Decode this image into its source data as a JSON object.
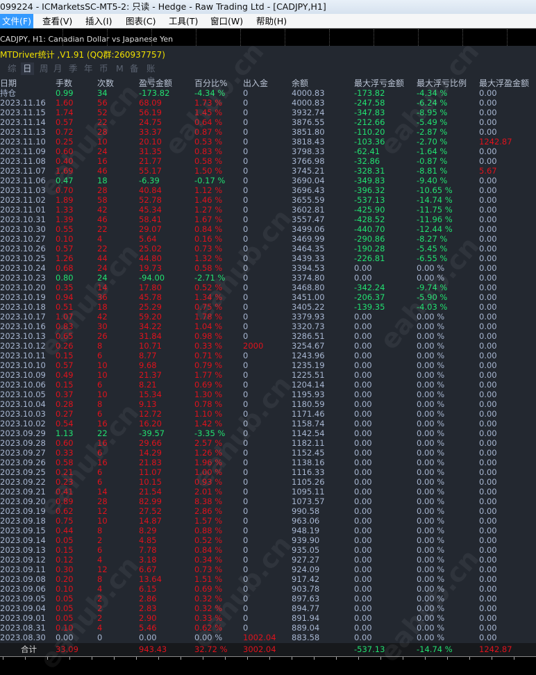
{
  "window": {
    "title": "099224 - ICMarketsSC-MT5-2: 只读 - Hedge - Raw Trading Ltd - [CADJPY,H1]"
  },
  "menu": [
    "文件(F)",
    "查看(V)",
    "插入(I)",
    "图表(C)",
    "工具(T)",
    "窗口(W)",
    "帮助(H)"
  ],
  "chart": {
    "symbol": "CADJPY, H1:  Canadian Dollar vs Japanese Yen"
  },
  "indicator": {
    "title": "MTDriver统计 ,V1.91 (QQ群:260937757)"
  },
  "tabs": [
    "综",
    "日",
    "周",
    "月",
    "季",
    "年",
    "币",
    "M",
    "备",
    "账户"
  ],
  "selected_tab": "日",
  "columns": [
    "日期",
    "手数",
    "次数",
    "盈亏金额",
    "百分比%",
    "出入金",
    "余额",
    "最大浮亏金额",
    "最大浮亏比例",
    "最大浮盈金额"
  ],
  "rows": [
    [
      "持仓",
      "0.99",
      "34",
      "-173.82",
      "-4.34 %",
      "0",
      "4000.83",
      "-173.82",
      "-4.34 %",
      "0.00"
    ],
    [
      "2023.11.16",
      "1.60",
      "56",
      "68.09",
      "1.73 %",
      "0",
      "4000.83",
      "-247.58",
      "-6.24 %",
      "0.00"
    ],
    [
      "2023.11.15",
      "1.74",
      "52",
      "56.19",
      "1.45 %",
      "0",
      "3932.74",
      "-347.83",
      "-8.95 %",
      "0.00"
    ],
    [
      "2023.11.14",
      "0.57",
      "22",
      "24.75",
      "0.64 %",
      "0",
      "3876.55",
      "-212.66",
      "-5.49 %",
      "0.00"
    ],
    [
      "2023.11.13",
      "0.72",
      "28",
      "33.37",
      "0.87 %",
      "0",
      "3851.80",
      "-110.20",
      "-2.87 %",
      "0.00"
    ],
    [
      "2023.11.10",
      "0.25",
      "10",
      "20.10",
      "0.53 %",
      "0",
      "3818.43",
      "-103.36",
      "-2.70 %",
      "1242.87"
    ],
    [
      "2023.11.09",
      "0.60",
      "24",
      "31.35",
      "0.83 %",
      "0",
      "3798.33",
      "-62.41",
      "-1.64 %",
      "0.00"
    ],
    [
      "2023.11.08",
      "0.40",
      "16",
      "21.77",
      "0.58 %",
      "0",
      "3766.98",
      "-32.86",
      "-0.87 %",
      "0.00"
    ],
    [
      "2023.11.07",
      "1.69",
      "46",
      "55.17",
      "1.50 %",
      "0",
      "3745.21",
      "-328.31",
      "-8.81 %",
      "5.67"
    ],
    [
      "2023.11.06",
      "0.47",
      "18",
      "-6.39",
      "-0.17 %",
      "0",
      "3690.04",
      "-349.83",
      "-9.40 %",
      "0.00"
    ],
    [
      "2023.11.03",
      "0.70",
      "28",
      "40.84",
      "1.12 %",
      "0",
      "3696.43",
      "-396.32",
      "-10.65 %",
      "0.00"
    ],
    [
      "2023.11.02",
      "1.89",
      "58",
      "52.78",
      "1.46 %",
      "0",
      "3655.59",
      "-537.13",
      "-14.74 %",
      "0.00"
    ],
    [
      "2023.11.01",
      "1.33",
      "42",
      "45.34",
      "1.27 %",
      "0",
      "3602.81",
      "-425.90",
      "-11.75 %",
      "0.00"
    ],
    [
      "2023.10.31",
      "1.39",
      "46",
      "58.41",
      "1.67 %",
      "0",
      "3557.47",
      "-428.52",
      "-11.96 %",
      "0.00"
    ],
    [
      "2023.10.30",
      "0.55",
      "22",
      "29.07",
      "0.84 %",
      "0",
      "3499.06",
      "-440.70",
      "-12.44 %",
      "0.00"
    ],
    [
      "2023.10.27",
      "0.10",
      "4",
      "5.64",
      "0.16 %",
      "0",
      "3469.99",
      "-290.86",
      "-8.27 %",
      "0.00"
    ],
    [
      "2023.10.26",
      "0.57",
      "22",
      "25.02",
      "0.73 %",
      "0",
      "3464.35",
      "-190.28",
      "-5.45 %",
      "0.00"
    ],
    [
      "2023.10.25",
      "1.26",
      "44",
      "44.80",
      "1.32 %",
      "0",
      "3439.33",
      "-226.81",
      "-6.55 %",
      "0.00"
    ],
    [
      "2023.10.24",
      "0.68",
      "24",
      "19.73",
      "0.58 %",
      "0",
      "3394.53",
      "0.00",
      "0.00 %",
      "0.00"
    ],
    [
      "2023.10.23",
      "0.80",
      "24",
      "-94.00",
      "-2.71 %",
      "0",
      "3374.80",
      "0.00",
      "0.00 %",
      "0.00"
    ],
    [
      "2023.10.20",
      "0.35",
      "14",
      "17.80",
      "0.52 %",
      "0",
      "3468.80",
      "-342.24",
      "-9.74 %",
      "0.00"
    ],
    [
      "2023.10.19",
      "0.94",
      "36",
      "45.78",
      "1.34 %",
      "0",
      "3451.00",
      "-206.37",
      "-5.90 %",
      "0.00"
    ],
    [
      "2023.10.18",
      "0.51",
      "18",
      "25.29",
      "0.75 %",
      "0",
      "3405.22",
      "-139.35",
      "-4.03 %",
      "0.00"
    ],
    [
      "2023.10.17",
      "1.07",
      "42",
      "59.20",
      "1.78 %",
      "0",
      "3379.93",
      "0.00",
      "0.00 %",
      "0.00"
    ],
    [
      "2023.10.16",
      "0.83",
      "30",
      "34.22",
      "1.04 %",
      "0",
      "3320.73",
      "0.00",
      "0.00 %",
      "0.00"
    ],
    [
      "2023.10.13",
      "0.65",
      "26",
      "31.84",
      "0.98 %",
      "0",
      "3286.51",
      "0.00",
      "0.00 %",
      "0.00"
    ],
    [
      "2023.10.12",
      "0.26",
      "8",
      "10.71",
      "0.33 %",
      "2000",
      "3254.67",
      "0.00",
      "0.00 %",
      "0.00"
    ],
    [
      "2023.10.11",
      "0.15",
      "6",
      "8.77",
      "0.71 %",
      "0",
      "1243.96",
      "0.00",
      "0.00 %",
      "0.00"
    ],
    [
      "2023.10.10",
      "0.57",
      "10",
      "9.68",
      "0.79 %",
      "0",
      "1235.19",
      "0.00",
      "0.00 %",
      "0.00"
    ],
    [
      "2023.10.09",
      "0.49",
      "10",
      "21.37",
      "1.77 %",
      "0",
      "1225.51",
      "0.00",
      "0.00 %",
      "0.00"
    ],
    [
      "2023.10.06",
      "0.15",
      "6",
      "8.21",
      "0.69 %",
      "0",
      "1204.14",
      "0.00",
      "0.00 %",
      "0.00"
    ],
    [
      "2023.10.05",
      "0.37",
      "10",
      "15.34",
      "1.30 %",
      "0",
      "1195.93",
      "0.00",
      "0.00 %",
      "0.00"
    ],
    [
      "2023.10.04",
      "0.28",
      "8",
      "9.13",
      "0.78 %",
      "0",
      "1180.59",
      "0.00",
      "0.00 %",
      "0.00"
    ],
    [
      "2023.10.03",
      "0.27",
      "6",
      "12.72",
      "1.10 %",
      "0",
      "1171.46",
      "0.00",
      "0.00 %",
      "0.00"
    ],
    [
      "2023.10.02",
      "0.54",
      "16",
      "16.20",
      "1.42 %",
      "0",
      "1158.74",
      "0.00",
      "0.00 %",
      "0.00"
    ],
    [
      "2023.09.29",
      "1.13",
      "22",
      "-39.57",
      "-3.35 %",
      "0",
      "1142.54",
      "0.00",
      "0.00 %",
      "0.00"
    ],
    [
      "2023.09.28",
      "0.60",
      "16",
      "29.66",
      "2.57 %",
      "0",
      "1182.11",
      "0.00",
      "0.00 %",
      "0.00"
    ],
    [
      "2023.09.27",
      "0.33",
      "6",
      "14.29",
      "1.26 %",
      "0",
      "1152.45",
      "0.00",
      "0.00 %",
      "0.00"
    ],
    [
      "2023.09.26",
      "0.58",
      "16",
      "21.83",
      "1.96 %",
      "0",
      "1138.16",
      "0.00",
      "0.00 %",
      "0.00"
    ],
    [
      "2023.09.25",
      "0.21",
      "6",
      "11.07",
      "1.00 %",
      "0",
      "1116.33",
      "0.00",
      "0.00 %",
      "0.00"
    ],
    [
      "2023.09.22",
      "0.23",
      "6",
      "10.15",
      "0.93 %",
      "0",
      "1105.26",
      "0.00",
      "0.00 %",
      "0.00"
    ],
    [
      "2023.09.21",
      "0.41",
      "14",
      "21.54",
      "2.01 %",
      "0",
      "1095.11",
      "0.00",
      "0.00 %",
      "0.00"
    ],
    [
      "2023.09.20",
      "0.89",
      "28",
      "82.99",
      "8.38 %",
      "0",
      "1073.57",
      "0.00",
      "0.00 %",
      "0.00"
    ],
    [
      "2023.09.19",
      "0.62",
      "12",
      "27.52",
      "2.86 %",
      "0",
      "990.58",
      "0.00",
      "0.00 %",
      "0.00"
    ],
    [
      "2023.09.18",
      "0.75",
      "10",
      "14.87",
      "1.57 %",
      "0",
      "963.06",
      "0.00",
      "0.00 %",
      "0.00"
    ],
    [
      "2023.09.15",
      "0.44",
      "8",
      "8.29",
      "0.88 %",
      "0",
      "948.19",
      "0.00",
      "0.00 %",
      "0.00"
    ],
    [
      "2023.09.14",
      "0.05",
      "2",
      "4.85",
      "0.52 %",
      "0",
      "939.90",
      "0.00",
      "0.00 %",
      "0.00"
    ],
    [
      "2023.09.13",
      "0.15",
      "6",
      "7.78",
      "0.84 %",
      "0",
      "935.05",
      "0.00",
      "0.00 %",
      "0.00"
    ],
    [
      "2023.09.12",
      "0.12",
      "4",
      "3.18",
      "0.34 %",
      "0",
      "927.27",
      "0.00",
      "0.00 %",
      "0.00"
    ],
    [
      "2023.09.11",
      "0.30",
      "12",
      "6.67",
      "0.73 %",
      "0",
      "924.09",
      "0.00",
      "0.00 %",
      "0.00"
    ],
    [
      "2023.09.08",
      "0.20",
      "8",
      "13.64",
      "1.51 %",
      "0",
      "917.42",
      "0.00",
      "0.00 %",
      "0.00"
    ],
    [
      "2023.09.06",
      "0.10",
      "4",
      "6.15",
      "0.69 %",
      "0",
      "903.78",
      "0.00",
      "0.00 %",
      "0.00"
    ],
    [
      "2023.09.05",
      "0.05",
      "2",
      "2.86",
      "0.32 %",
      "0",
      "897.63",
      "0.00",
      "0.00 %",
      "0.00"
    ],
    [
      "2023.09.04",
      "0.05",
      "2",
      "2.83",
      "0.32 %",
      "0",
      "894.77",
      "0.00",
      "0.00 %",
      "0.00"
    ],
    [
      "2023.09.01",
      "0.05",
      "2",
      "2.90",
      "0.33 %",
      "0",
      "891.94",
      "0.00",
      "0.00 %",
      "0.00"
    ],
    [
      "2023.08.31",
      "0.10",
      "4",
      "5.46",
      "0.62 %",
      "0",
      "889.04",
      "0.00",
      "0.00 %",
      "0.00"
    ],
    [
      "2023.08.30",
      "0.00",
      "0",
      "0.00",
      "0.00 %",
      "1002.04",
      "883.58",
      "0.00",
      "0.00 %",
      "0.00"
    ]
  ],
  "total": [
    "合计",
    "33.09",
    "",
    "943.43",
    "32.72 %",
    "3002.04",
    "",
    "-537.13",
    "-14.74 %",
    "1242.87"
  ],
  "watermark": "eahub.cn",
  "colors": {
    "profit": "#e0121c",
    "loss": "#22e070",
    "text": "#a8b7d2",
    "indicator": "#f0e000",
    "menu_active": "#3399ff"
  }
}
